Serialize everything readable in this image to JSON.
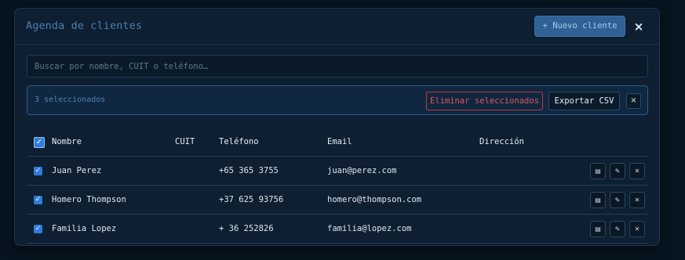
{
  "modal": {
    "title": "Agenda de clientes",
    "new_client_label": "+ Nuevo cliente",
    "close_label": "×"
  },
  "search": {
    "placeholder": "Buscar por nombre, CUIT o teléfono…",
    "value": ""
  },
  "selection": {
    "count_text": "3 seleccionados",
    "delete_label": "Eliminar seleccionados",
    "export_label": "Exportar CSV",
    "clear_label": "×"
  },
  "table": {
    "select_all_checked": true,
    "check_glyph": "✓",
    "columns": {
      "name": "Nombre",
      "cuit": "CUIT",
      "phone": "Teléfono",
      "email": "Email",
      "address": "Dirección"
    },
    "rows": [
      {
        "checked": true,
        "name": "Juan Perez",
        "cuit": "",
        "phone": "+65 365 3755",
        "email": "juan@perez.com",
        "address": ""
      },
      {
        "checked": true,
        "name": "Homero Thompson",
        "cuit": "",
        "phone": "+37 625 93756",
        "email": "homero@thompson.com",
        "address": ""
      },
      {
        "checked": true,
        "name": "Familia Lopez",
        "cuit": "",
        "phone": "+ 36 252826",
        "email": "familia@lopez.com",
        "address": ""
      }
    ],
    "row_actions": {
      "view_icon": "▤",
      "edit_icon": "✎",
      "delete_icon": "✕"
    }
  },
  "colors": {
    "page_bg": "#071520",
    "modal_bg": "#0d1f30",
    "accent": "#2f6196",
    "danger": "#e0575c",
    "checkbox": "#2f7de0"
  }
}
